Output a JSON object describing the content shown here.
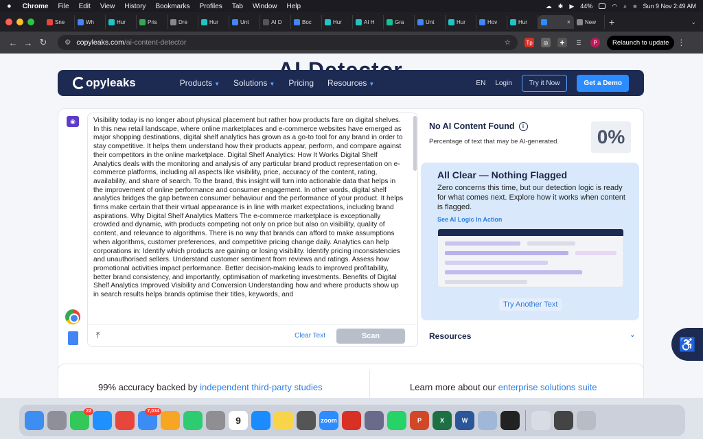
{
  "menubar": {
    "apple": "",
    "app_name": "Chrome",
    "items": [
      "File",
      "Edit",
      "View",
      "History",
      "Bookmarks",
      "Profiles",
      "Tab",
      "Window",
      "Help"
    ],
    "battery": "44%",
    "datetime": "Sun 9 Nov  2:49 AM"
  },
  "tabs": [
    {
      "label": "Sne",
      "color": "#e8453c"
    },
    {
      "label": "Wh",
      "color": "#4285f4"
    },
    {
      "label": "Hur",
      "color": "#21c4c4"
    },
    {
      "label": "Pris",
      "color": "#34a853"
    },
    {
      "label": "Dre",
      "color": "#888888"
    },
    {
      "label": "Hur",
      "color": "#21c4c4"
    },
    {
      "label": "Unt",
      "color": "#4285f4"
    },
    {
      "label": "AI D",
      "color": "#555555"
    },
    {
      "label": "Boc",
      "color": "#4285f4"
    },
    {
      "label": "Hur",
      "color": "#21c4c4"
    },
    {
      "label": "AI H",
      "color": "#21c4c4"
    },
    {
      "label": "Gra",
      "color": "#15c39a"
    },
    {
      "label": "Unt",
      "color": "#4285f4"
    },
    {
      "label": "Hur",
      "color": "#21c4c4"
    },
    {
      "label": "Hov",
      "color": "#4285f4"
    },
    {
      "label": "Hur",
      "color": "#21c4c4"
    }
  ],
  "active_tab": {
    "label": "",
    "close": "×"
  },
  "new_tab_label": "New",
  "address": {
    "host": "copyleaks.com",
    "path": "/ai-content-detector",
    "relaunch": "Relaunch to update"
  },
  "page": {
    "big_title": "AI Detector",
    "nav": {
      "logo": "opyleaks",
      "links": [
        "Products",
        "Solutions",
        "Pricing",
        "Resources"
      ],
      "lang": "EN",
      "login": "Login",
      "try_it": "Try it Now",
      "demo": "Get a Demo"
    },
    "editor": {
      "text": "Visibility today is no longer about physical placement but rather how products fare on digital shelves. In this new retail landscape, where online marketplaces and e-commerce websites have emerged as major shopping destinations, digital shelf analytics has grown as a go-to tool for any brand in order to stay competitive. It helps them understand how their products appear, perform, and compare against their competitors in the online marketplace. Digital Shelf Analytics: How It Works Digital Shelf Analytics deals with the monitoring and analysis of any particular brand product representation on e-commerce platforms, including all aspects like visibility, price, accuracy of the content, rating, availability, and share of search. To the brand, this insight will turn into actionable data that helps in the improvement of online performance and consumer engagement. In other words, digital shelf analytics bridges the gap between consumer behaviour and the performance of your product. It helps firms make certain that their virtual appearance is in line with market expectations, including brand aspirations. Why Digital Shelf Analytics Matters The e-commerce marketplace is exceptionally crowded and dynamic, with products competing not only on price but also on visibility, quality of content, and relevance to algorithms. There is no way that brands can afford to make assumptions when algorithms, customer preferences, and competitive pricing change daily. Analytics can help corporations in: Identify which products are gaining or losing visibility. Identify pricing inconsistencies and unauthorised sellers. Understand customer sentiment from reviews and ratings. Assess how promotional activities impact performance. Better decision-making leads to improved profitability, better brand consistency, and importantly, optimisation of marketing investments. Benefits of Digital Shelf Analytics Improved Visibility and Conversion Understanding how and where products show up in search results helps brands optimise their titles, keywords, and",
      "clear": "Clear Text",
      "scan": "Scan"
    },
    "result": {
      "title": "No AI Content Found",
      "desc": "Percentage of text that may be AI-generated.",
      "percent": "0%"
    },
    "all_clear": {
      "title": "All Clear — Nothing Flagged",
      "desc": "Zero concerns this time, but our detection logic is ready for what comes next. Explore how it works when content is flagged.",
      "link": "See AI Logic In Action",
      "try_another": "Try Another Text"
    },
    "resources": "Resources",
    "bottom": {
      "left_prefix": "99% accuracy backed by ",
      "left_link": "independent third-party studies",
      "right_prefix": "Learn more about our ",
      "right_link": "enterprise solutions suite"
    }
  },
  "dock": {
    "apps": [
      {
        "name": "finder",
        "color": "#3d8ef0",
        "label": ""
      },
      {
        "name": "launchpad",
        "color": "#8f8f9a",
        "label": ""
      },
      {
        "name": "messages",
        "color": "#34c759",
        "label": "",
        "badge": "22"
      },
      {
        "name": "safari",
        "color": "#1e90ff",
        "label": ""
      },
      {
        "name": "chrome",
        "color": "#e8453c",
        "label": ""
      },
      {
        "name": "mail",
        "color": "#3b8cf5",
        "label": "",
        "badge": "7,034"
      },
      {
        "name": "photos",
        "color": "#f6a623",
        "label": ""
      },
      {
        "name": "facetime",
        "color": "#2ecc71",
        "label": ""
      },
      {
        "name": "settings",
        "color": "#8e8e93",
        "label": ""
      },
      {
        "name": "calendar",
        "color": "#ffffff",
        "label": "9"
      },
      {
        "name": "app-store",
        "color": "#1a8cff",
        "label": ""
      },
      {
        "name": "notes",
        "color": "#f7d44a",
        "label": ""
      },
      {
        "name": "calculator",
        "color": "#555555",
        "label": ""
      },
      {
        "name": "zoom",
        "color": "#2d8cff",
        "label": "zoom"
      },
      {
        "name": "presenter",
        "color": "#d93025",
        "label": ""
      },
      {
        "name": "iphone-mirror",
        "color": "#6a6a8a",
        "label": ""
      },
      {
        "name": "whatsapp",
        "color": "#25d366",
        "label": ""
      },
      {
        "name": "powerpoint",
        "color": "#d24726",
        "label": "P"
      },
      {
        "name": "excel",
        "color": "#1d7044",
        "label": "X"
      },
      {
        "name": "word",
        "color": "#2b579a",
        "label": "W"
      },
      {
        "name": "preview",
        "color": "#9fb8d8",
        "label": ""
      },
      {
        "name": "terminal",
        "color": "#222222",
        "label": ""
      },
      {
        "name": "documents",
        "color": "#d8dce4",
        "label": ""
      },
      {
        "name": "screenshots",
        "color": "#444444",
        "label": ""
      },
      {
        "name": "trash",
        "color": "#b8bcc4",
        "label": ""
      }
    ]
  }
}
